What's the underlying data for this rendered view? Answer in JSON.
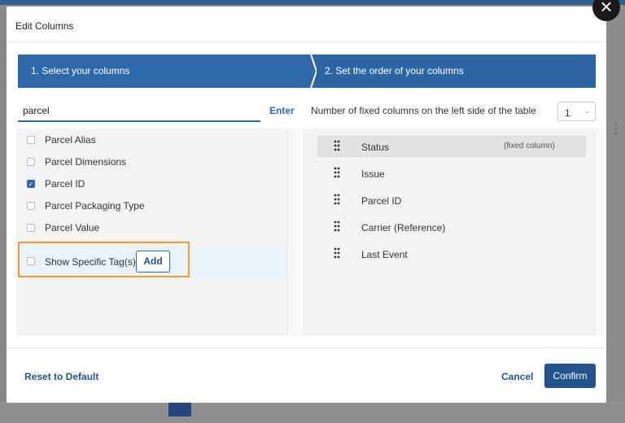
{
  "modal": {
    "title": "Edit Columns"
  },
  "steps": [
    {
      "label": "1. Select your columns"
    },
    {
      "label": "2. Set the order of your columns"
    }
  ],
  "search": {
    "value": "parcel",
    "enter_label": "Enter"
  },
  "available_columns": [
    {
      "label": "Parcel Alias",
      "checked": false
    },
    {
      "label": "Parcel Dimensions",
      "checked": false
    },
    {
      "label": "Parcel ID",
      "checked": true
    },
    {
      "label": "Parcel Packaging Type",
      "checked": false
    },
    {
      "label": "Parcel Value",
      "checked": false
    },
    {
      "label": "Show Specific Tag(s)",
      "checked": false
    }
  ],
  "add_label": "Add",
  "fixed_columns": {
    "label": "Number of fixed columns on the left side of the table",
    "value": "1"
  },
  "ordered_columns": [
    {
      "label": "Status",
      "note": "(fixed column)"
    },
    {
      "label": "Issue"
    },
    {
      "label": "Parcel ID"
    },
    {
      "label": "Carrier (Reference)"
    },
    {
      "label": "Last Event"
    }
  ],
  "footer": {
    "reset_label": "Reset to Default",
    "cancel_label": "Cancel",
    "confirm_label": "Confirm"
  },
  "colors": {
    "primary": "#2f68a8",
    "primary_dark": "#24528a",
    "highlight_border": "#f39a2d"
  }
}
